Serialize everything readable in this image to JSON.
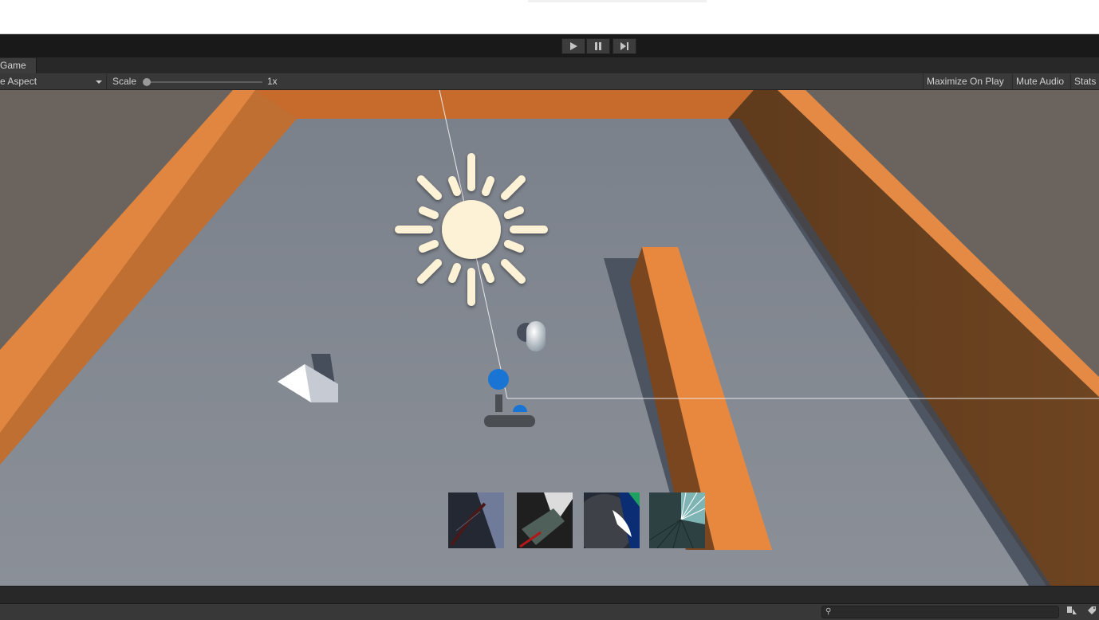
{
  "window": {
    "game_tab_label": "Game"
  },
  "play_controls": {
    "play_icon": "play-icon",
    "pause_icon": "pause-icon",
    "step_icon": "step-icon"
  },
  "game_toolbar": {
    "aspect_label": "e Aspect",
    "scale_label": "Scale",
    "scale_value_label": "1x",
    "scale_level": 0,
    "maximize_label": "Maximize On Play",
    "mute_label": "Mute Audio",
    "stats_label": "Stats"
  },
  "scene": {
    "sun_icon": "directional-light-gizmo",
    "camera_icon": "camera-gizmo",
    "colors": {
      "floor": "#7a808b",
      "wall": "#e58a45",
      "wall_shadow": "#6c421f",
      "sky": "#6b645e",
      "sun": "#fdf1d6",
      "gizmo_blue": "#1a74d4"
    }
  },
  "bottom_bar": {
    "search_icon": "search-icon",
    "layers_icon": "layers-icon",
    "tag_icon": "tag-icon"
  }
}
